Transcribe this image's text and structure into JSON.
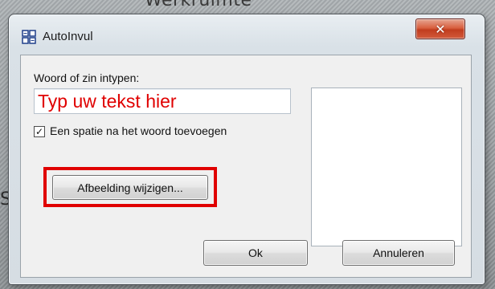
{
  "background": {
    "heading": "Werkruimte",
    "partial_letter": "S"
  },
  "window": {
    "title": "AutoInvul",
    "close_glyph": "✕"
  },
  "form": {
    "prompt_label": "Woord of zin intypen:",
    "input_value": "Typ uw tekst hier",
    "checkbox_checked": true,
    "checkbox_glyph": "✓",
    "checkbox_label": "Een spatie na het woord toevoegen",
    "change_image_button": "Afbeelding wijzigen...",
    "ok_button": "Ok",
    "cancel_button": "Annuleren"
  },
  "colors": {
    "highlight": "#e00000",
    "input_text": "#e00000",
    "close_button": "#c94428"
  },
  "icons": {
    "app": "autoinvul-grid-icon",
    "close": "close-icon",
    "check": "checkmark-icon"
  }
}
